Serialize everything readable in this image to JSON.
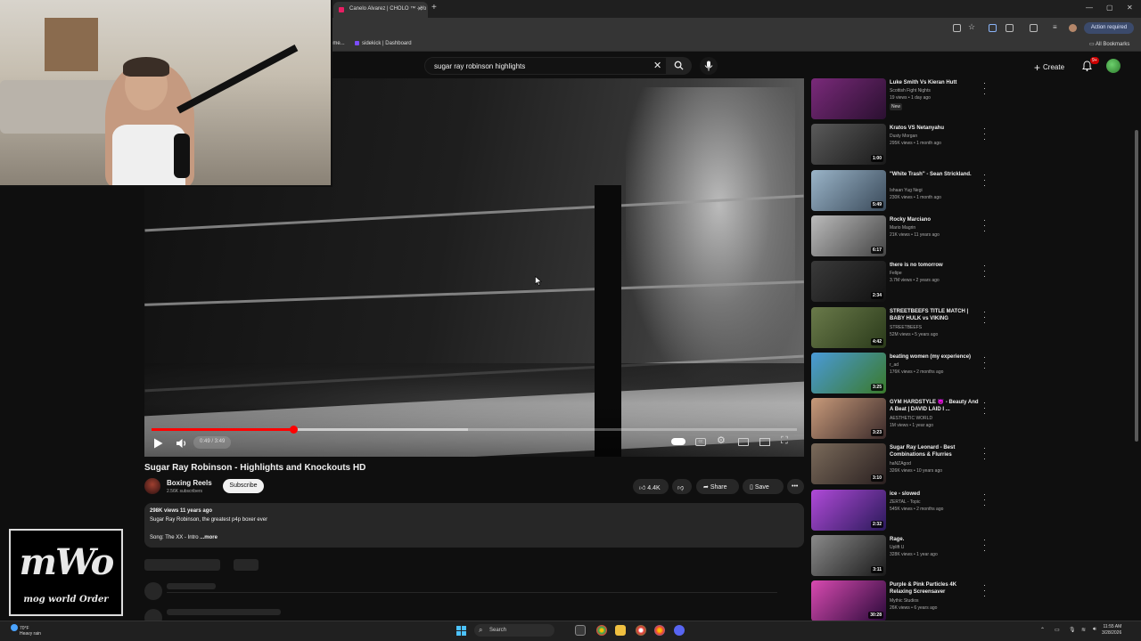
{
  "browser": {
    "tab_title": "Canelo Alvarez | CHOLO ™ - Yo",
    "bookmarks": [
      "ome...",
      "sidekick | Dashboard"
    ],
    "action_required": "Action required",
    "all_bookmarks": "All Bookmarks"
  },
  "youtube": {
    "search_query": "sugar ray robinson highlights",
    "create_label": "Create",
    "notification_count": "9+"
  },
  "player": {
    "time": "0:49 / 3:49",
    "progress_fraction": 0.22,
    "buffered_fraction": 0.49
  },
  "video": {
    "title": "Sugar Ray Robinson - Highlights and Knockouts HD",
    "channel": "Boxing Reels",
    "subscribers": "2.56K subscribers",
    "subscribe_label": "Subscribe",
    "likes": "4.4K",
    "share_label": "Share",
    "save_label": "Save",
    "views_age": "298K views  11 years ago",
    "description": "Sugar Ray Robinson, the greatest p4p boxer ever",
    "song_prefix": "Song: The XX - Intro",
    "more_label": "...more"
  },
  "logo": {
    "big": "mWo",
    "small": "mog world Order"
  },
  "recommendations": [
    {
      "title": "Luke Smith Vs Kieran Hutt",
      "channel": "Scottish Fight Nights",
      "meta": "19 views • 1 day ago",
      "badge": "New",
      "duration": "",
      "colors": [
        "#7a2a7a",
        "#2a1030"
      ]
    },
    {
      "title": "Kratos VS Netanyahu",
      "channel": "Dusty Morgan",
      "meta": "295K views • 1 month ago",
      "badge": "",
      "duration": "1:00",
      "colors": [
        "#5a5a5a",
        "#1a1a1a"
      ]
    },
    {
      "title": "\"White Trash\" - Sean Strickland.",
      "channel": "Ishaan Yug Negi",
      "meta": "230K views • 1 month ago",
      "badge": "",
      "duration": "5:49",
      "colors": [
        "#9ab4c8",
        "#3a4a5a"
      ]
    },
    {
      "title": "Rocky Marciano",
      "channel": "Mario Magrin",
      "meta": "21K views • 11 years ago",
      "badge": "",
      "duration": "6:17",
      "colors": [
        "#bbbbbb",
        "#444444"
      ]
    },
    {
      "title": "there is no tomorrow",
      "channel": "Felipe",
      "meta": "3.7M views • 2 years ago",
      "badge": "",
      "duration": "2:34",
      "colors": [
        "#3a3a3a",
        "#111111"
      ]
    },
    {
      "title": "STREETBEEFS TITLE MATCH | BABY HULK vs VIKING",
      "channel": "STREETBEEFS",
      "meta": "52M views • 5 years ago",
      "badge": "",
      "duration": "4:42",
      "colors": [
        "#6a7a4a",
        "#2a3a1a"
      ]
    },
    {
      "title": "beating women (my experience)",
      "channel": "r_ad",
      "meta": "176K views • 2 months ago",
      "badge": "",
      "duration": "3:25",
      "colors": [
        "#4a9ad8",
        "#3a7a2a"
      ]
    },
    {
      "title": "GYM HARDSTYLE 😈 - Beauty And A Beat | DAVID LAID I ...",
      "channel": "AESTHETIC WORLD",
      "meta": "1M views • 1 year ago",
      "badge": "",
      "duration": "3:23",
      "colors": [
        "#c89a7a",
        "#3a2a2a"
      ]
    },
    {
      "title": "Sugar Ray Leonard - Best Combinations & Flurries",
      "channel": "haNZAgod",
      "meta": "326K views • 10 years ago",
      "badge": "",
      "duration": "3:10",
      "colors": [
        "#7a6a5a",
        "#2a2020"
      ]
    },
    {
      "title": "ice - slowed",
      "channel": "ZERTAL - Topic",
      "meta": "545K views • 2 months ago",
      "badge": "",
      "duration": "2:32",
      "colors": [
        "#b04ad8",
        "#2a1a5a"
      ]
    },
    {
      "title": "Rage.",
      "channel": "Uplift U",
      "meta": "328K views • 1 year ago",
      "badge": "",
      "duration": "3:11",
      "colors": [
        "#8a8a8a",
        "#1a1a1a"
      ]
    },
    {
      "title": "Purple & Pink Particles 4K Relaxing Screensaver",
      "channel": "Mythic Studios",
      "meta": "26K views • 6 years ago",
      "badge": "",
      "duration": "30:28",
      "colors": [
        "#d84ab0",
        "#2a0a3a"
      ]
    }
  ],
  "taskbar": {
    "weather_temp": "70°F",
    "weather_desc": "Heavy rain",
    "search_label": "Search",
    "time": "11:55 AM",
    "date": "3/28/2026"
  }
}
